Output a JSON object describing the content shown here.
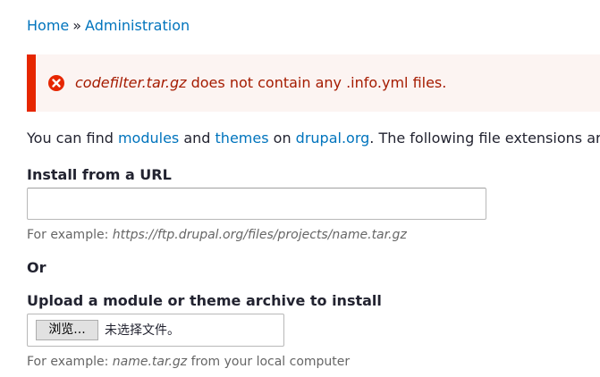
{
  "breadcrumb": {
    "home": "Home",
    "separator": "»",
    "administration": "Administration"
  },
  "error_message": {
    "filename": "codefilter.tar.gz",
    "text": " does not contain any .info.yml files.",
    "icon": "error-circle-icon",
    "color": "#e62600"
  },
  "intro": {
    "prefix": "You can find ",
    "modules_link": "modules",
    "and": " and ",
    "themes_link": "themes",
    "on": " on ",
    "drupal_link": "drupal.org",
    "suffix": ". The following file extensions ar"
  },
  "install_url": {
    "label": "Install from a URL",
    "value": "",
    "example_prefix": "For example: ",
    "example_value": "https://ftp.drupal.org/files/projects/name.tar.gz"
  },
  "or_label": "Or",
  "upload": {
    "label": "Upload a module or theme archive to install",
    "browse_button": "浏览...",
    "no_file_text": "未选择文件。",
    "example_prefix": "For example: ",
    "example_value": "name.tar.gz",
    "example_suffix": " from your local computer"
  },
  "colors": {
    "link": "#0074bd",
    "error_text": "#a51b00",
    "error_bg": "#fcf4f2"
  }
}
